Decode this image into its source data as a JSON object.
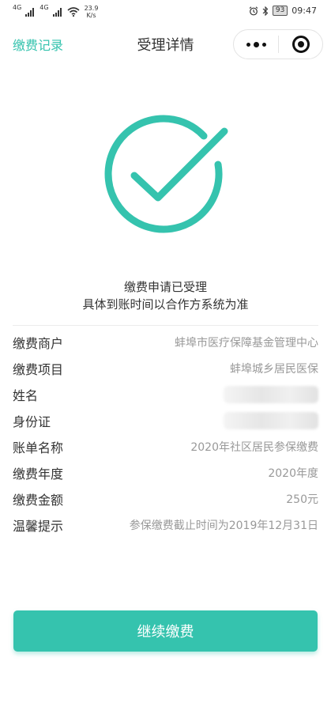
{
  "status_bar": {
    "signal_1": "4G",
    "signal_2": "4G",
    "net_speed_value": "23.9",
    "net_speed_unit": "K/s",
    "battery": "93",
    "time": "09:47"
  },
  "nav": {
    "back_label": "缴费记录",
    "title": "受理详情"
  },
  "result": {
    "icon": "check-circle-icon",
    "color": "#35c3ae",
    "line1": "缴费申请已受理",
    "line2": "具体到账时间以合作方系统为准"
  },
  "details": [
    {
      "label": "缴费商户",
      "value": "蚌埠市医疗保障基金管理中心"
    },
    {
      "label": "缴费项目",
      "value": "蚌埠城乡居民医保"
    },
    {
      "label": "姓名",
      "value": ""
    },
    {
      "label": "身份证",
      "value": ""
    },
    {
      "label": "账单名称",
      "value": "2020年社区居民参保缴费"
    },
    {
      "label": "缴费年度",
      "value": "2020年度"
    },
    {
      "label": "缴费金额",
      "value": "250元"
    },
    {
      "label": "温馨提示",
      "value": "参保缴费截止时间为2019年12月31日"
    }
  ],
  "actions": {
    "continue_label": "继续缴费"
  }
}
